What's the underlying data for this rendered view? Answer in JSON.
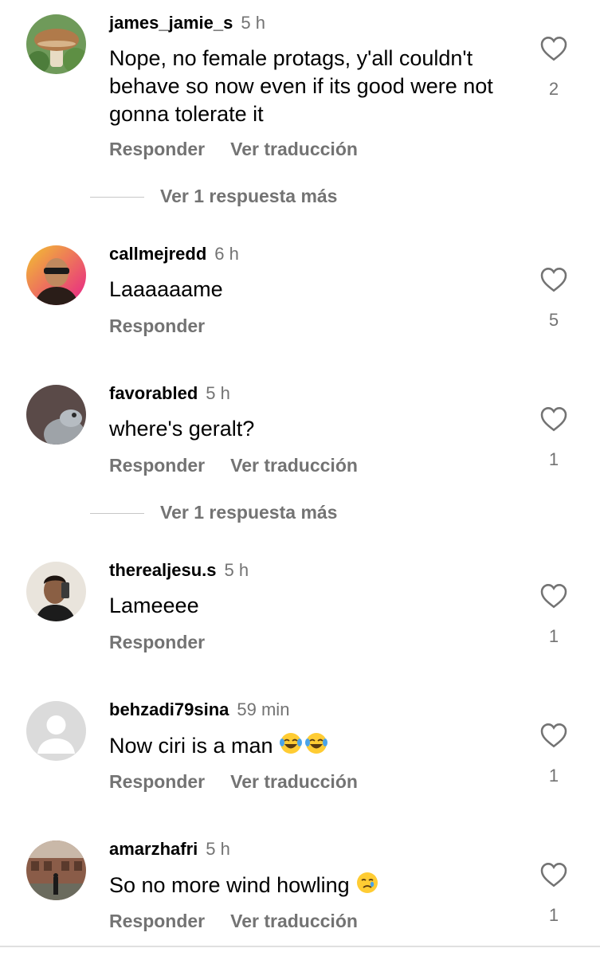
{
  "comments": [
    {
      "username": "james_jamie_s",
      "time": "5 h",
      "text": "Nope, no female protags, y'all couldn't behave so now even if its good were not gonna tolerate it",
      "reply_label": "Responder",
      "translate_label": "Ver traducción",
      "likes": "2",
      "more_replies": "Ver 1 respuesta más"
    },
    {
      "username": "callmejredd",
      "time": "6 h",
      "text": "Laaaaaame",
      "reply_label": "Responder",
      "likes": "5"
    },
    {
      "username": "favorabled",
      "time": "5 h",
      "text": "where's geralt?",
      "reply_label": "Responder",
      "translate_label": "Ver traducción",
      "likes": "1",
      "more_replies": "Ver 1 respuesta más"
    },
    {
      "username": "therealjesu.s",
      "time": "5 h",
      "text": "Lameeee",
      "reply_label": "Responder",
      "likes": "1"
    },
    {
      "username": "behzadi79sina",
      "time": "59 min",
      "text": "Now ciri is a man",
      "emoji": "😂😂",
      "reply_label": "Responder",
      "translate_label": "Ver traducción",
      "likes": "1"
    },
    {
      "username": "amarzhafri",
      "time": "5 h",
      "text": "So no more wind howling",
      "emoji": "🥲",
      "reply_label": "Responder",
      "translate_label": "Ver traducción",
      "likes": "1"
    }
  ],
  "icons": {
    "like": "heart-outline-icon",
    "avatar_placeholder": "default-user-icon",
    "laugh_emoji": "face-with-tears-of-joy-emoji",
    "tear_emoji": "smiling-face-with-tear-emoji"
  },
  "colors": {
    "secondary_text": "#737373",
    "divider": "#c7c7c7"
  }
}
